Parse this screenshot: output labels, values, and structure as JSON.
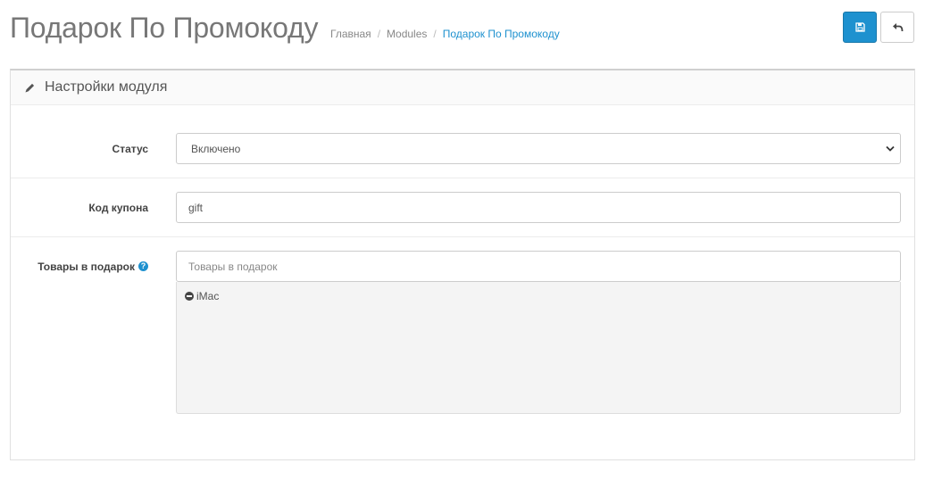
{
  "header": {
    "title": "Подарок По Промокоду",
    "breadcrumb": [
      "Главная",
      "Modules",
      "Подарок По Промокоду"
    ],
    "save_icon": "floppy-disk-icon",
    "back_icon": "reply-arrow-icon",
    "accent_color": "#1e91cf"
  },
  "panel": {
    "heading": "Настройки модуля",
    "heading_icon": "pencil-icon"
  },
  "form": {
    "status": {
      "label": "Статус",
      "value": "Включено"
    },
    "coupon": {
      "label": "Код купона",
      "value": "gift"
    },
    "gifts": {
      "label": "Товары в подарок",
      "placeholder": "Товары в подарок",
      "help_icon": "question-circle-icon",
      "items": [
        "iMac"
      ]
    }
  }
}
